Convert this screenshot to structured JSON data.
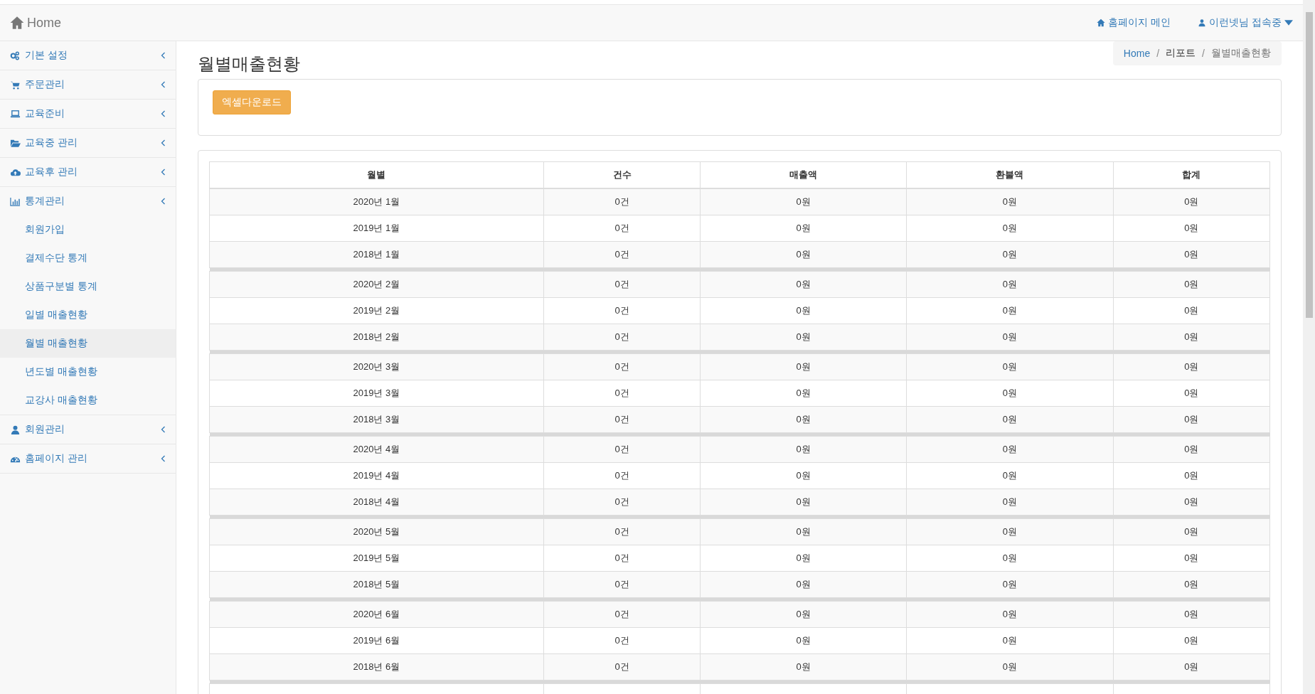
{
  "navbar": {
    "brand": "Home",
    "links": [
      {
        "label": "홈페이지 메인"
      },
      {
        "label": "이런넷님 접속중",
        "dropdown": true
      }
    ]
  },
  "sidebar": {
    "items": [
      {
        "label": "기본 설정",
        "expanded": false
      },
      {
        "label": "주문관리",
        "expanded": false
      },
      {
        "label": "교육준비",
        "expanded": false
      },
      {
        "label": "교육중 관리",
        "expanded": false
      },
      {
        "label": "교육후 관리",
        "expanded": false
      },
      {
        "label": "통계관리",
        "expanded": true,
        "children": [
          {
            "label": "회원가입",
            "selected": false
          },
          {
            "label": "결제수단 통계",
            "selected": false
          },
          {
            "label": "상품구분별 통계",
            "selected": false
          },
          {
            "label": "일별 매출현황",
            "selected": false
          },
          {
            "label": "월별 매출현황",
            "selected": true
          },
          {
            "label": "년도별 매출현황",
            "selected": false
          },
          {
            "label": "교강사 매출현황",
            "selected": false
          }
        ]
      },
      {
        "label": "회원관리",
        "expanded": false
      },
      {
        "label": "홈페이지 관리",
        "expanded": false
      }
    ]
  },
  "page": {
    "title": "월별매출현황",
    "breadcrumb": [
      "Home",
      "리포트",
      "월별매출현황"
    ],
    "breadcrumb_separator": "/",
    "excel_button": "엑셀다운로드"
  },
  "table": {
    "columns": [
      "월별",
      "건수",
      "매출액",
      "환불액",
      "합계"
    ],
    "groups": [
      {
        "rows": [
          [
            "2020년 1월",
            "0건",
            "0원",
            "0원",
            "0원"
          ],
          [
            "2019년 1월",
            "0건",
            "0원",
            "0원",
            "0원"
          ],
          [
            "2018년 1월",
            "0건",
            "0원",
            "0원",
            "0원"
          ]
        ]
      },
      {
        "rows": [
          [
            "2020년 2월",
            "0건",
            "0원",
            "0원",
            "0원"
          ],
          [
            "2019년 2월",
            "0건",
            "0원",
            "0원",
            "0원"
          ],
          [
            "2018년 2월",
            "0건",
            "0원",
            "0원",
            "0원"
          ]
        ]
      },
      {
        "rows": [
          [
            "2020년 3월",
            "0건",
            "0원",
            "0원",
            "0원"
          ],
          [
            "2019년 3월",
            "0건",
            "0원",
            "0원",
            "0원"
          ],
          [
            "2018년 3월",
            "0건",
            "0원",
            "0원",
            "0원"
          ]
        ]
      },
      {
        "rows": [
          [
            "2020년 4월",
            "0건",
            "0원",
            "0원",
            "0원"
          ],
          [
            "2019년 4월",
            "0건",
            "0원",
            "0원",
            "0원"
          ],
          [
            "2018년 4월",
            "0건",
            "0원",
            "0원",
            "0원"
          ]
        ]
      },
      {
        "rows": [
          [
            "2020년 5월",
            "0건",
            "0원",
            "0원",
            "0원"
          ],
          [
            "2019년 5월",
            "0건",
            "0원",
            "0원",
            "0원"
          ],
          [
            "2018년 5월",
            "0건",
            "0원",
            "0원",
            "0원"
          ]
        ]
      },
      {
        "rows": [
          [
            "2020년 6월",
            "0건",
            "0원",
            "0원",
            "0원"
          ],
          [
            "2019년 6월",
            "0건",
            "0원",
            "0원",
            "0원"
          ],
          [
            "2018년 6월",
            "0건",
            "0원",
            "0원",
            "0원"
          ]
        ]
      }
    ]
  }
}
